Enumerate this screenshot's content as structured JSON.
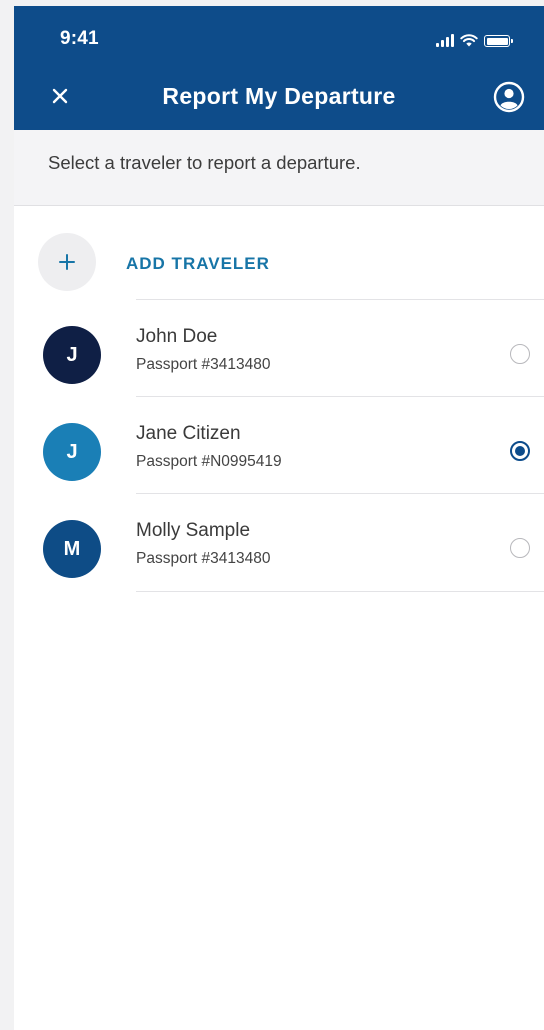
{
  "status_bar": {
    "time": "9:41"
  },
  "nav": {
    "title": "Report My Departure",
    "close_icon": "close-icon",
    "profile_icon": "account-circle-icon"
  },
  "instructions": "Select a traveler to report a departure.",
  "add_traveler": {
    "label": "ADD TRAVELER",
    "icon": "plus-icon"
  },
  "travelers": [
    {
      "initial": "J",
      "name": "John Doe",
      "passport": "Passport #3413480",
      "avatar_color": "#0f1f45",
      "selected": false
    },
    {
      "initial": "J",
      "name": "Jane Citizen",
      "passport": "Passport #N0995419",
      "avatar_color": "#1a7fb6",
      "selected": true
    },
    {
      "initial": "M",
      "name": "Molly Sample",
      "passport": "Passport #3413480",
      "avatar_color": "#0e4c86",
      "selected": false
    }
  ],
  "colors": {
    "header_bg": "#0e4c8a",
    "accent": "#1775a7",
    "radio_selected": "#0d4c8b"
  }
}
